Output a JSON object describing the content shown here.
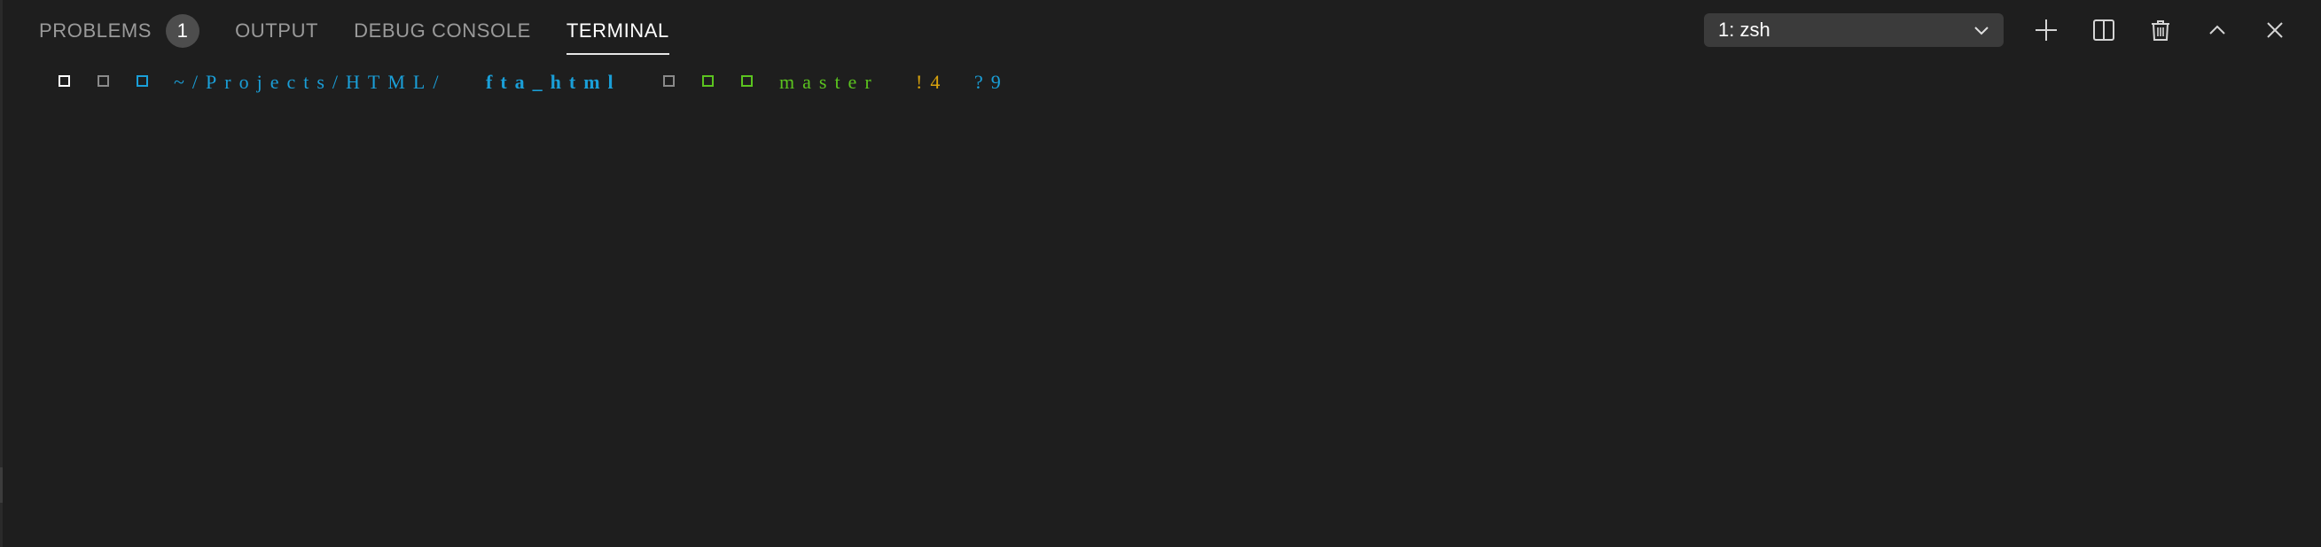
{
  "panel": {
    "tabs": [
      {
        "label": "PROBLEMS",
        "badge": "1"
      },
      {
        "label": "OUTPUT"
      },
      {
        "label": "DEBUG CONSOLE"
      },
      {
        "label": "TERMINAL"
      }
    ],
    "active_tab": "TERMINAL"
  },
  "toolbar": {
    "terminal_select": {
      "selected": "1: zsh",
      "icon": "chevron-down-icon"
    },
    "buttons": [
      {
        "name": "new-terminal",
        "icon": "plus-icon"
      },
      {
        "name": "split-terminal",
        "icon": "split-icon"
      },
      {
        "name": "kill-terminal",
        "icon": "trash-icon"
      },
      {
        "name": "maximize-panel",
        "icon": "chevron-up-icon"
      },
      {
        "name": "close-panel",
        "icon": "close-icon"
      }
    ]
  },
  "terminal": {
    "prompt": {
      "path_prefix": "~/Projects/HTML/",
      "path_dir": "fta_html",
      "branch": "master",
      "modified": "!4",
      "untracked": "?9"
    }
  },
  "colors": {
    "background": "#1e1e1e",
    "tab_inactive": "#9a9a9a",
    "tab_active": "#ffffff",
    "path": "#1a9fd8",
    "git_branch": "#5bc41f",
    "git_modified": "#d8a20d",
    "git_untracked": "#1a9fd8"
  }
}
